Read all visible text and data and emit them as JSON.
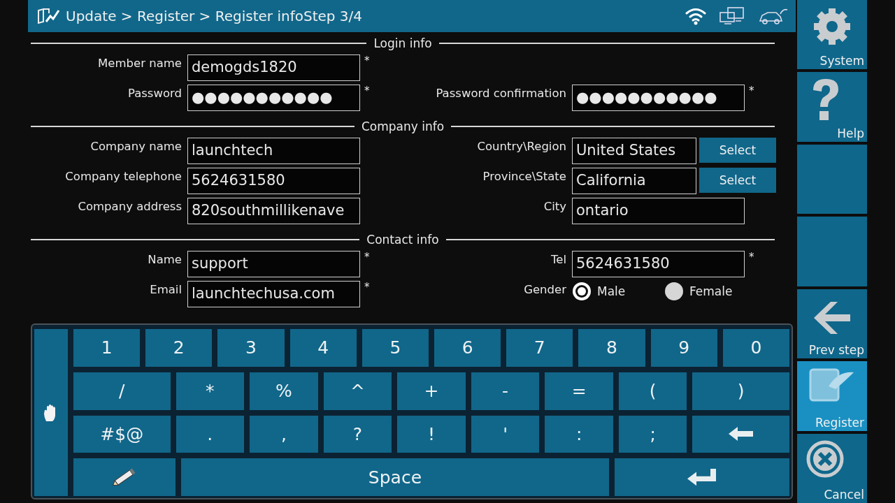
{
  "header": {
    "breadcrumb": "Update > Register > Register infoStep 3/4"
  },
  "sections": [
    {
      "title": "Login info",
      "rows": [
        {
          "left": {
            "kind": "text",
            "label": "Member name",
            "value": "demogds1820",
            "asterisk": "*"
          }
        },
        {
          "left": {
            "kind": "text",
            "label": "Password",
            "value": "●●●●●●●●●●●",
            "asterisk": "*"
          },
          "right": {
            "kind": "text",
            "label": "Password confirmation",
            "value": "●●●●●●●●●●●",
            "asterisk": "*"
          }
        }
      ]
    },
    {
      "title": "Company info",
      "rows": [
        {
          "left": {
            "kind": "text",
            "label": "Company name",
            "value": "launchtech"
          },
          "right": {
            "kind": "select",
            "label": "Country\\Region",
            "value": "United States",
            "button": "Select"
          }
        },
        {
          "left": {
            "kind": "text",
            "label": "Company telephone",
            "value": "5624631580"
          },
          "right": {
            "kind": "select",
            "label": "Province\\State",
            "value": "California",
            "button": "Select"
          }
        },
        {
          "left": {
            "kind": "text",
            "label": "Company address",
            "value": "820southmillikenave"
          },
          "right": {
            "kind": "text",
            "label": "City",
            "value": "ontario"
          }
        }
      ]
    },
    {
      "title": "Contact info",
      "rows": [
        {
          "left": {
            "kind": "text",
            "label": "Name",
            "value": "support",
            "asterisk": "*"
          },
          "right": {
            "kind": "text",
            "label": "Tel",
            "value": "5624631580",
            "asterisk": "*"
          }
        },
        {
          "left": {
            "kind": "text",
            "label": "Email",
            "value": "launchtechusa.com",
            "asterisk": "*"
          },
          "right": {
            "kind": "radio",
            "label": "Gender",
            "options": [
              {
                "label": "Male",
                "selected": true
              },
              {
                "label": "Female",
                "selected": false
              }
            ]
          }
        }
      ]
    }
  ],
  "keyboard": {
    "rows": [
      [
        {
          "kind": "key",
          "label": "1"
        },
        {
          "kind": "key",
          "label": "2"
        },
        {
          "kind": "key",
          "label": "3"
        },
        {
          "kind": "key",
          "label": "4"
        },
        {
          "kind": "key",
          "label": "5"
        },
        {
          "kind": "key",
          "label": "6"
        },
        {
          "kind": "key",
          "label": "7"
        },
        {
          "kind": "key",
          "label": "8"
        },
        {
          "kind": "key",
          "label": "9"
        },
        {
          "kind": "key",
          "label": "0"
        }
      ],
      [
        {
          "kind": "wide",
          "label": "/"
        },
        {
          "kind": "key",
          "label": "*"
        },
        {
          "kind": "key",
          "label": "%"
        },
        {
          "kind": "key",
          "label": "^"
        },
        {
          "kind": "key",
          "label": "+"
        },
        {
          "kind": "key",
          "label": "-"
        },
        {
          "kind": "key",
          "label": "="
        },
        {
          "kind": "key",
          "label": "("
        },
        {
          "kind": "wide",
          "label": ")"
        }
      ],
      [
        {
          "kind": "wide",
          "label": "#$@"
        },
        {
          "kind": "key",
          "label": "."
        },
        {
          "kind": "key",
          "label": ","
        },
        {
          "kind": "key",
          "label": "?"
        },
        {
          "kind": "key",
          "label": "!"
        },
        {
          "kind": "key",
          "label": "'"
        },
        {
          "kind": "key",
          "label": ":"
        },
        {
          "kind": "key",
          "label": ";"
        },
        {
          "kind": "backspace"
        }
      ],
      [
        {
          "kind": "pencil"
        },
        {
          "kind": "space",
          "label": "Space"
        },
        {
          "kind": "enter"
        }
      ]
    ]
  },
  "sidebar": {
    "items": [
      {
        "kind": "gear",
        "label": "System",
        "selected": false
      },
      {
        "kind": "help",
        "label": "Help",
        "selected": false
      },
      {
        "kind": "blank",
        "selected": false
      },
      {
        "kind": "blank",
        "selected": false
      },
      {
        "kind": "back",
        "label": "Prev step",
        "selected": false
      },
      {
        "kind": "register",
        "label": "Register",
        "selected": true
      },
      {
        "kind": "cancel",
        "label": "Cancel",
        "selected": false
      }
    ]
  }
}
